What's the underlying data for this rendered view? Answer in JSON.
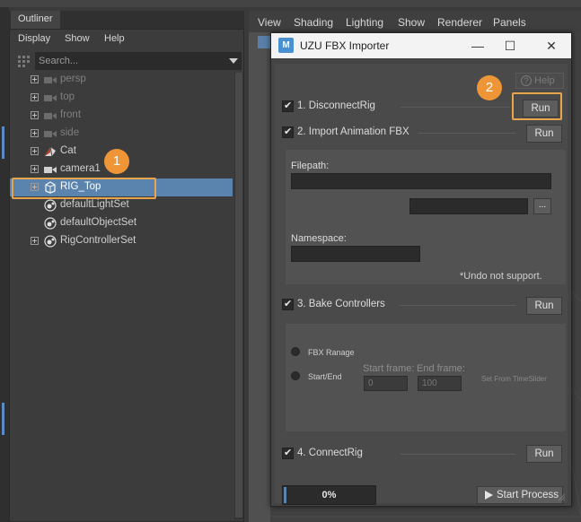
{
  "outliner": {
    "tab_label": "Outliner",
    "menu": [
      "Display",
      "Show",
      "Help"
    ],
    "search_placeholder": "Search...",
    "items": [
      {
        "label": "persp",
        "icon": "camera-icon",
        "dim": true,
        "expandable": true
      },
      {
        "label": "top",
        "icon": "camera-icon",
        "dim": true,
        "expandable": true
      },
      {
        "label": "front",
        "icon": "camera-icon",
        "dim": true,
        "expandable": true
      },
      {
        "label": "side",
        "icon": "camera-icon",
        "dim": true,
        "expandable": true
      },
      {
        "label": "Cat",
        "icon": "mesh-icon",
        "dim": false,
        "expandable": true
      },
      {
        "label": "camera1",
        "icon": "camera-icon",
        "dim": false,
        "expandable": true
      },
      {
        "label": "RIG_Top",
        "icon": "group-icon",
        "dim": false,
        "expandable": true,
        "selected": true
      },
      {
        "label": "defaultLightSet",
        "icon": "set-icon",
        "dim": false,
        "expandable": false
      },
      {
        "label": "defaultObjectSet",
        "icon": "set-icon",
        "dim": false,
        "expandable": false
      },
      {
        "label": "RigControllerSet",
        "icon": "set-icon",
        "dim": false,
        "expandable": true
      }
    ]
  },
  "viewport_menu": [
    "View",
    "Shading",
    "Lighting",
    "Show",
    "Renderer",
    "Panels"
  ],
  "badges": {
    "one": "1",
    "two": "2"
  },
  "dialog": {
    "title": "UZU FBX Importer",
    "app_icon_letter": "M",
    "help_label": "Help",
    "step1": {
      "label": "1. DisconnectRig",
      "run": "Run"
    },
    "step2": {
      "label": "2. Import Animation FBX",
      "run": "Run"
    },
    "filepath_label": "Filepath:",
    "filepath_value": "",
    "browse_label": "...",
    "namespace_label": "Namespace:",
    "namespace_value": "",
    "undo_note": "*Undo not support.",
    "step3": {
      "label": "3. Bake Controllers",
      "run": "Run"
    },
    "radio_fbx": "FBX Ranage",
    "radio_startend": "Start/End",
    "start_frame_label": "Start frame:",
    "end_frame_label": "End frame:",
    "start_frame_value": "0",
    "end_frame_value": "100",
    "set_from_timeslider": "Set From TimeSlider",
    "step4": {
      "label": "4. ConnectRig",
      "run": "Run"
    },
    "progress_text": "0%",
    "progress_fraction": 0.0,
    "start_process_label": "Start Process"
  },
  "colors": {
    "accent": "#5a83ad",
    "highlight": "#e8a54b",
    "badge": "#ee9637"
  }
}
